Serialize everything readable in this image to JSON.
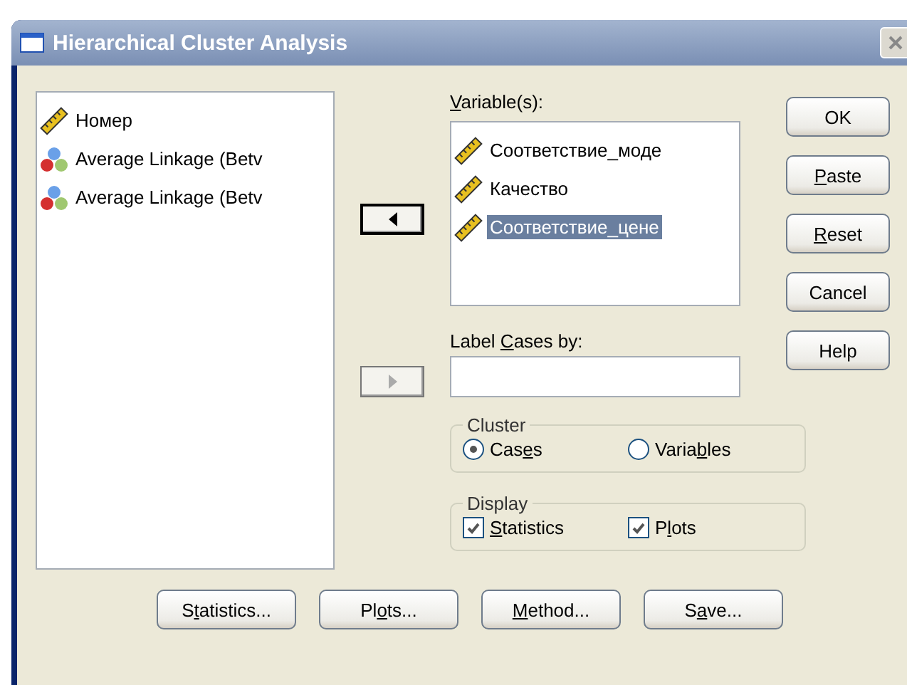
{
  "window": {
    "title": "Hierarchical Cluster Analysis"
  },
  "source_list": {
    "items": [
      {
        "label": "Номер",
        "kind": "ruler",
        "selected": false
      },
      {
        "label": "Average Linkage (Betv",
        "kind": "balls",
        "selected": false
      },
      {
        "label": "Average Linkage (Betv",
        "kind": "balls",
        "selected": false
      }
    ]
  },
  "move_buttons": [
    {
      "kind": "left",
      "disabled": false
    },
    {
      "kind": "right",
      "disabled": true
    }
  ],
  "variables": {
    "label": {
      "key": "V",
      "after": "ariable(s):"
    },
    "items": [
      {
        "label": "Соответствие_моде",
        "kind": "ruler",
        "selected": false
      },
      {
        "label": "Качество",
        "kind": "ruler",
        "selected": false
      },
      {
        "label": "Соответствие_цене",
        "kind": "ruler",
        "selected": true
      }
    ]
  },
  "label_cases": {
    "label": {
      "before": "Label ",
      "key": "C",
      "after": "ases by:"
    }
  },
  "cluster": {
    "title": "Cluster",
    "options": [
      {
        "label": {
          "before": "Cas",
          "key": "e",
          "after": "s"
        },
        "selected": true
      },
      {
        "label": {
          "before": "Varia",
          "key": "b",
          "after": "les"
        },
        "selected": false
      }
    ]
  },
  "display": {
    "title": "Display",
    "options": [
      {
        "label": {
          "key": "S",
          "after": "tatistics"
        },
        "checked": true
      },
      {
        "label": {
          "before": "P",
          "key": "l",
          "after": "ots"
        },
        "checked": true
      }
    ]
  },
  "side_buttons": [
    {
      "label": {
        "before": "OK"
      }
    },
    {
      "label": {
        "key": "P",
        "after": "aste"
      }
    },
    {
      "label": {
        "key": "R",
        "after": "eset"
      }
    },
    {
      "label": {
        "before": "Cancel"
      }
    },
    {
      "label": {
        "before": "Help"
      }
    }
  ],
  "bottom_buttons": [
    {
      "label": {
        "before": "S",
        "key": "t",
        "after": "atistics..."
      }
    },
    {
      "label": {
        "before": "Pl",
        "key": "o",
        "after": "ts..."
      }
    },
    {
      "label": {
        "key": "M",
        "after": "ethod..."
      }
    },
    {
      "label": {
        "before": "S",
        "key": "a",
        "after": "ve..."
      }
    }
  ]
}
